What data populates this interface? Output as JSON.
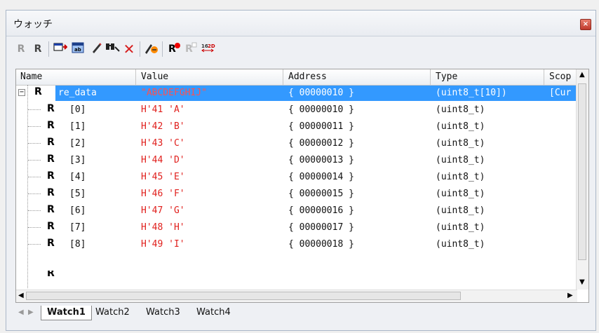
{
  "window": {
    "title": "ウォッチ",
    "close_icon": "close-icon"
  },
  "toolbar": {
    "icons": [
      "refresh-icon",
      "refresh-all-icon",
      "add-watch-icon",
      "edit-value-icon",
      "edit-icon",
      "find-icon",
      "delete-icon",
      "auto-update-icon",
      "register-breakpoint-icon",
      "clear-breakpoint-icon",
      "hex-dec-toggle-icon"
    ]
  },
  "columns": [
    "Name",
    "Value",
    "Address",
    "Type",
    "Scop"
  ],
  "rows": [
    {
      "name": "re_data",
      "value": "\"ABCDEFGHIJ\"",
      "address": "{ 00000010 }",
      "type": "(uint8_t[10])",
      "scope": "[Cur"
    },
    {
      "name": "[0]",
      "value": "H'41 'A'",
      "address": "{ 00000010 }",
      "type": "(uint8_t)"
    },
    {
      "name": "[1]",
      "value": "H'42 'B'",
      "address": "{ 00000011 }",
      "type": "(uint8_t)"
    },
    {
      "name": "[2]",
      "value": "H'43 'C'",
      "address": "{ 00000012 }",
      "type": "(uint8_t)"
    },
    {
      "name": "[3]",
      "value": "H'44 'D'",
      "address": "{ 00000013 }",
      "type": "(uint8_t)"
    },
    {
      "name": "[4]",
      "value": "H'45 'E'",
      "address": "{ 00000014 }",
      "type": "(uint8_t)"
    },
    {
      "name": "[5]",
      "value": "H'46 'F'",
      "address": "{ 00000015 }",
      "type": "(uint8_t)"
    },
    {
      "name": "[6]",
      "value": "H'47 'G'",
      "address": "{ 00000016 }",
      "type": "(uint8_t)"
    },
    {
      "name": "[7]",
      "value": "H'48 'H'",
      "address": "{ 00000017 }",
      "type": "(uint8_t)"
    },
    {
      "name": "[8]",
      "value": "H'49 'I'",
      "address": "{ 00000018 }",
      "type": "(uint8_t)"
    }
  ],
  "row_glyph": "R",
  "tabs": [
    "Watch1",
    "Watch2",
    "Watch3",
    "Watch4"
  ],
  "active_tab": "Watch1",
  "colors": {
    "selection": "#3399ff",
    "value_red": "#e0201d"
  }
}
